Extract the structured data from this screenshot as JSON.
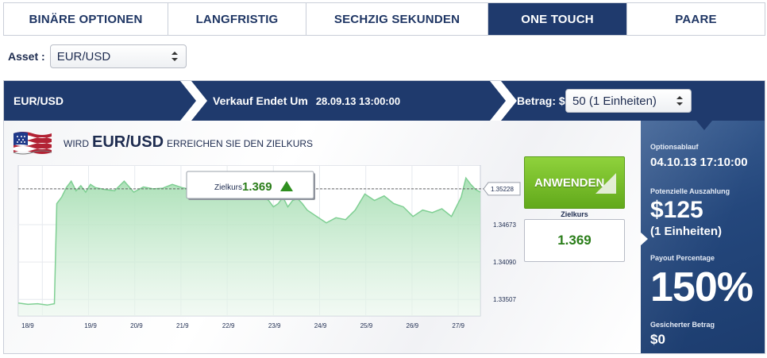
{
  "tabs": [
    {
      "label": "BINÄRE OPTIONEN",
      "active": false
    },
    {
      "label": "LANGFRISTIG",
      "active": false
    },
    {
      "label": "SECHZIG SEKUNDEN",
      "active": false
    },
    {
      "label": "ONE TOUCH",
      "active": true
    },
    {
      "label": "PAARE",
      "active": false
    }
  ],
  "asset": {
    "label": "Asset :",
    "value": "EUR/USD"
  },
  "header": {
    "asset": "EUR/USD",
    "sale_ends_label": "Verkauf Endet Um",
    "sale_ends_value": "28.09.13 13:00:00",
    "amount_label": "Betrag: $",
    "amount_value": "50 (1 Einheiten)"
  },
  "headline": {
    "prefix": "WIRD",
    "asset": "EUR/USD",
    "suffix": "ERREICHEN SIE DEN ZIELKURS"
  },
  "target": {
    "tooltip_label": "Zielkurs",
    "tooltip_value": "1.369",
    "box_label": "Zielkurs",
    "box_value": "1.369"
  },
  "apply_button": "ANWENDEN",
  "side": {
    "expiry_label": "Optionsablauf",
    "expiry_value": "04.10.13 17:10:00",
    "payout_label": "Potenzielle Auszahlung",
    "payout_value": "$125",
    "payout_units": "(1 Einheiten)",
    "percentage_label": "Payout Percentage",
    "percentage_value": "150%",
    "secured_label": "Gesicherter Betrag",
    "secured_value": "$0"
  },
  "colors": {
    "navy": "#1f3a6d",
    "green": "#6ab423",
    "area": "#a8dfb4"
  },
  "chart_data": {
    "type": "area",
    "x_tick_labels": [
      "18/9",
      "19/9",
      "20/9",
      "21/9",
      "22/9",
      "23/9",
      "24/9",
      "25/9",
      "26/9",
      "27/9"
    ],
    "y_tick_labels": [
      "1.35228",
      "1.34673",
      "1.34090",
      "1.33507"
    ],
    "ylim": [
      1.3325,
      1.356
    ],
    "target_line": 1.3523,
    "x": [
      0,
      0.2,
      0.4,
      0.6,
      0.75,
      0.8,
      0.9,
      1.0,
      1.1,
      1.2,
      1.3,
      1.4,
      1.5,
      1.6,
      1.8,
      2.0,
      2.2,
      2.4,
      2.6,
      2.8,
      3.0,
      3.2,
      3.4,
      3.6,
      3.8,
      4.0,
      4.2,
      4.4,
      4.6,
      4.8,
      5.0,
      5.1,
      5.2,
      5.3,
      5.4,
      5.5,
      5.6,
      5.7,
      5.8,
      5.9,
      6.0,
      6.2,
      6.4,
      6.6,
      6.8,
      7.0,
      7.2,
      7.4,
      7.6,
      7.8,
      8.0,
      8.2,
      8.4,
      8.6,
      8.8,
      9.0,
      9.2,
      9.3,
      9.4,
      9.5,
      9.6
    ],
    "y": [
      1.3345,
      1.3343,
      1.3344,
      1.3342,
      1.3344,
      1.35,
      1.351,
      1.3525,
      1.3535,
      1.352,
      1.3528,
      1.3518,
      1.353,
      1.3525,
      1.3522,
      1.352,
      1.3535,
      1.3518,
      1.3526,
      1.3523,
      1.3524,
      1.353,
      1.3525,
      1.3522,
      1.3528,
      1.3524,
      1.3522,
      1.353,
      1.3526,
      1.3527,
      1.3525,
      1.351,
      1.3505,
      1.3495,
      1.35,
      1.351,
      1.3495,
      1.3505,
      1.3508,
      1.35,
      1.349,
      1.348,
      1.347,
      1.3478,
      1.3475,
      1.349,
      1.3515,
      1.3505,
      1.3512,
      1.35,
      1.3495,
      1.348,
      1.349,
      1.3486,
      1.3492,
      1.348,
      1.351,
      1.354,
      1.353,
      1.3522,
      1.3518
    ]
  }
}
